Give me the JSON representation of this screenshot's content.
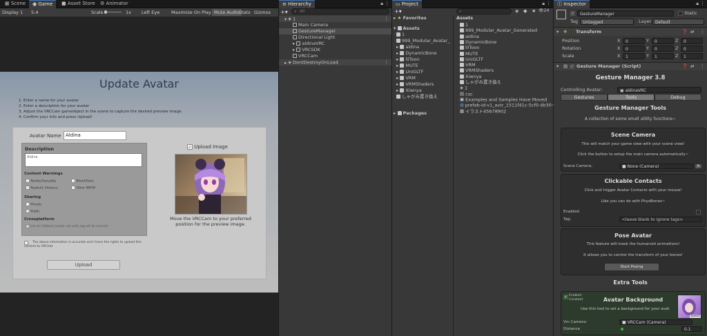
{
  "game_tabs": {
    "scene": "Scene",
    "game": "Game",
    "asset_store": "Asset Store",
    "animator": "Animator"
  },
  "game_toolbar": {
    "display": "Display 1",
    "aspect": "5:4",
    "scale_label": "Scale",
    "scale_value": "1x",
    "eye": "Left Eye",
    "maximize": "Maximize On Play",
    "mute": "Mute Audio",
    "stats": "Stats",
    "gizmos": "Gizmos"
  },
  "upload": {
    "title": "Update Avatar",
    "steps": [
      "1. Enter a name for your avatar",
      "2. Enter a description for your avatar",
      "3. Adjust the VRCCam gameobject in the scene to capture the desired preview image.",
      "4. Confirm your info and press Upload!"
    ],
    "name_label": "Avatar Name",
    "name_value": "Aldina",
    "description_label": "Description",
    "description_value": "Aldina",
    "content_warnings_label": "Content Warnings",
    "warnings": [
      "Nudity/Sexuality",
      "Blood/Gore",
      "Realistic Violence",
      "Other NSFW"
    ],
    "sharing_label": "Sharing",
    "sharing_options": [
      "Private",
      "Public"
    ],
    "crossplatform_label": "Crossplatform",
    "crossplatform_text": "Use for Fallback (avatar not valid, tag will be cleared)",
    "upload_image_label": "Upload Image",
    "preview_caption": "Move the VRCCam to your preferred position for the preview image.",
    "rights_text": "The above information is accurate and I have the rights to upload this content to VRChat.",
    "upload_button": "Upload"
  },
  "hierarchy": {
    "tab": "Hierarchy",
    "search_placeholder": "All",
    "items": [
      {
        "label": "1",
        "indent": 0,
        "type": "scene"
      },
      {
        "label": "Main Camera",
        "indent": 1,
        "type": "obj"
      },
      {
        "label": "GestureManager",
        "indent": 1,
        "type": "obj",
        "selected": true
      },
      {
        "label": "Directional Light",
        "indent": 1,
        "type": "obj"
      },
      {
        "label": "aldinaVRC",
        "indent": 1,
        "type": "obj",
        "arrow": true
      },
      {
        "label": "VRCSDK",
        "indent": 1,
        "type": "obj",
        "arrow": true
      },
      {
        "label": "VRCCam",
        "indent": 1,
        "type": "obj"
      },
      {
        "label": "DontDestroyOnLoad",
        "indent": 0,
        "type": "scene",
        "arrow": true
      }
    ]
  },
  "project": {
    "tab": "Project",
    "favorites": "Favorites",
    "assets_root": "Assets",
    "packages": "Packages",
    "assets_header": "Assets",
    "tree": [
      "1",
      "999_Modular_Avatar_",
      "aldina",
      "DynamicBone",
      "lilToon",
      "MUTE",
      "UniGLTF",
      "VRM",
      "VRMShaders",
      "Xiwnya",
      "しゃがみ置き換え"
    ],
    "files": [
      "1",
      "999_Modular_Avatar_Generated",
      "aldina",
      "DynamicBone",
      "lilToon",
      "MUTE",
      "UniGLTF",
      "VRM",
      "VRMShaders",
      "Xiwnya",
      "しゃがみ置き換え",
      "1",
      "csc",
      "Examples and Samples Have Moved",
      "prefab-id-v1_avtr_1511f41c-5cf0-4b30-9",
      "イラスト45678902"
    ],
    "count": "24"
  },
  "inspector": {
    "tab": "Inspector",
    "object_name": "GestureManager",
    "static_label": "Static",
    "tag_label": "Tag",
    "tag_value": "Untagged",
    "layer_label": "Layer",
    "layer_value": "Default",
    "transform_title": "Transform",
    "position_label": "Position",
    "rotation_label": "Rotation",
    "scale_label": "Scale",
    "position": [
      "0",
      "0",
      "0"
    ],
    "rotation": [
      "0",
      "0",
      "0"
    ],
    "scale": [
      "1",
      "1",
      "1"
    ],
    "script_title": "Gesture Manager (Script)",
    "gm_title": "Gesture Manager 3.8",
    "controlling_label": "Controlling Avatar:",
    "controlling_value": "aldinaVRC",
    "tabs": [
      "Gestures",
      "Tools",
      "Debug"
    ],
    "tools_title": "Gesture Manager Tools",
    "tools_subtitle": "A collection of some small utility functions~",
    "scene_camera_title": "Scene Camera",
    "scene_camera_text1": "This will match your game view with your scene view!",
    "scene_camera_text2": "Click the button to setup the main camera automatically~",
    "scene_camera_label": "Scene Camera:",
    "scene_camera_value": "None (Camera)",
    "contacts_title": "Clickable Contacts",
    "contacts_text1": "Click and trigger Avatar Contacts with your mouse!",
    "contacts_text2": "Like you can do with PhysBones~",
    "enabled_label": "Enabled:",
    "tag_field_label": "Tag:",
    "tag_field_value": "<leave blank to ignore tags>",
    "pose_title": "Pose Avatar",
    "pose_text1": "This feature will mask the humanoid animations!",
    "pose_text2": "It allows you to control the transform of your bones!",
    "pose_button": "Start Posing",
    "extra_title": "Extra Tools",
    "bg_title": "Avatar Background",
    "bg_enabled": "Enabled",
    "bg_constant": "Constant",
    "bg_text": "Use this tool to set a background for your avat",
    "vrc_camera_label": "Vrc Camera:",
    "vrc_camera_value": "VRCCam (Camera)",
    "distance_label": "Distance",
    "distance_value": "0.1",
    "select_label": "Select"
  },
  "colors": {
    "accent": "#3a79bb",
    "selected": "#2c5d87",
    "green_card": "#2d3b2d"
  }
}
